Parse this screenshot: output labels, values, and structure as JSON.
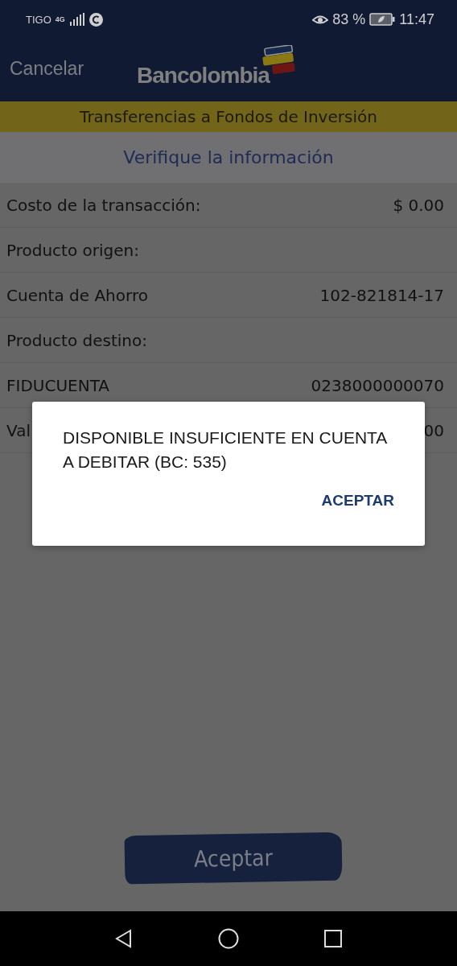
{
  "status_bar": {
    "carrier": "TIGO",
    "network": "4G",
    "battery": "83 %",
    "time": "11:47"
  },
  "header": {
    "cancel": "Cancelar",
    "logo": "Bancolombia"
  },
  "banner": "Transferencias a Fondos de Inversión",
  "section_title": "Verifique la información",
  "rows": [
    {
      "label": "Costo de la transacción:",
      "value": "$ 0.00"
    },
    {
      "label": "Producto origen:"
    },
    {
      "label": "Cuenta de Ahorro",
      "value": "102-821814-17"
    },
    {
      "label": "Producto destino:"
    },
    {
      "label": "FIDUCUENTA",
      "value": "0238000000070"
    },
    {
      "label": "Val",
      "value": "00"
    }
  ],
  "dialog": {
    "message": "DISPONIBLE INSUFICIENTE EN CUENTA A DEBITAR (BC: 535)",
    "button": "ACEPTAR"
  },
  "accept_button": "Aceptar"
}
